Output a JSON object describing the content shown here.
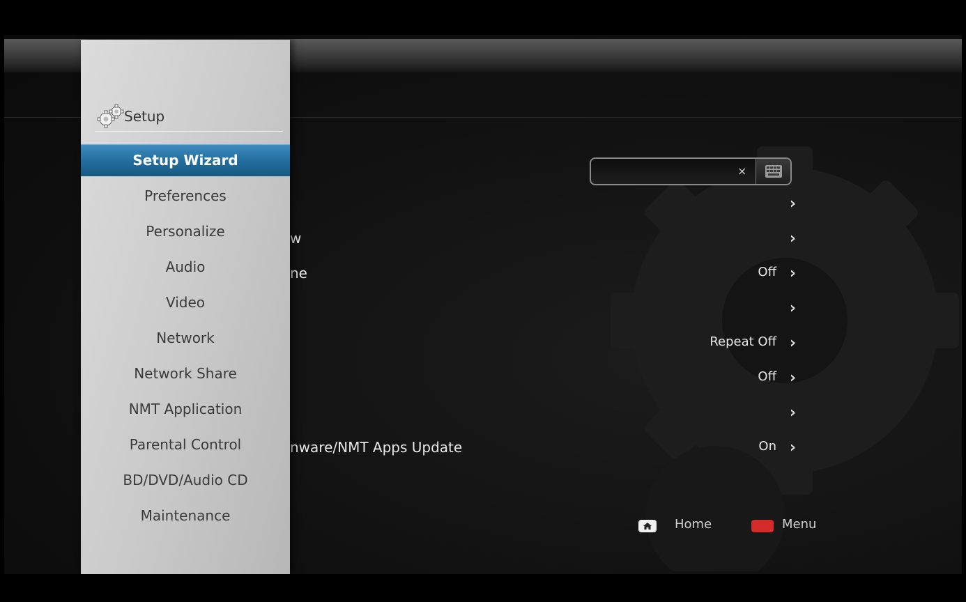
{
  "sidebar": {
    "title": "Setup",
    "title_icon": "gears-icon",
    "items": [
      {
        "label": "Setup Wizard",
        "selected": true
      },
      {
        "label": "Preferences"
      },
      {
        "label": "Personalize"
      },
      {
        "label": "Audio"
      },
      {
        "label": "Video"
      },
      {
        "label": "Network"
      },
      {
        "label": "Network Share"
      },
      {
        "label": "NMT Application"
      },
      {
        "label": "Parental Control"
      },
      {
        "label": "BD/DVD/Audio CD"
      },
      {
        "label": "Maintenance"
      }
    ]
  },
  "main": {
    "input": {
      "value": "",
      "placeholder": ""
    },
    "rows": [
      {
        "label": "",
        "value": "",
        "icon": "chevron-right-icon"
      },
      {
        "label": "w",
        "value": "",
        "icon": "chevron-right-icon"
      },
      {
        "label": "ne",
        "value": "Off",
        "icon": "chevron-right-icon"
      },
      {
        "label": "",
        "value": "",
        "icon": "chevron-right-icon"
      },
      {
        "label": "",
        "value": "Repeat Off",
        "icon": "chevron-right-icon"
      },
      {
        "label": "",
        "value": "Off",
        "icon": "chevron-right-icon"
      },
      {
        "label": "",
        "value": "",
        "icon": "chevron-right-icon"
      },
      {
        "label": "nware/NMT Apps Update",
        "value": "On",
        "icon": "chevron-right-icon"
      }
    ]
  },
  "footer": {
    "home_label": "Home",
    "menu_label": "Menu",
    "home_icon": "home-icon",
    "menu_key_color": "#d42a2a"
  },
  "colors": {
    "selection": "#2a76a8",
    "sidebar_bg": "#cfcfcf",
    "background": "#111111"
  }
}
